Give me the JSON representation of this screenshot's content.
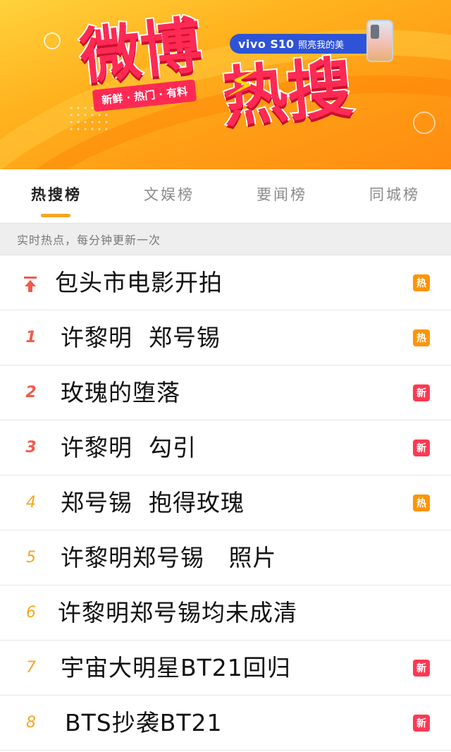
{
  "banner": {
    "logo_top": "微博",
    "logo_bottom": "热搜",
    "tagline": "新鲜 · 热门 · 有料",
    "ad_brand": "vivo",
    "ad_model": "S10",
    "ad_slogan": "照亮我的美"
  },
  "tabs": [
    {
      "label": "热搜榜",
      "active": true
    },
    {
      "label": "文娱榜",
      "active": false
    },
    {
      "label": "要闻榜",
      "active": false
    },
    {
      "label": "同城榜",
      "active": false
    }
  ],
  "subheader": "实时热点，每分钟更新一次",
  "list": [
    {
      "rank": "",
      "pinned": true,
      "title": "包头市电影开拍",
      "badge": "热",
      "badge_type": "hot"
    },
    {
      "rank": "1",
      "pinned": false,
      "title": "许黎明  郑号锡",
      "badge": "热",
      "badge_type": "hot"
    },
    {
      "rank": "2",
      "pinned": false,
      "title": "玫瑰的堕落",
      "badge": "新",
      "badge_type": "new"
    },
    {
      "rank": "3",
      "pinned": false,
      "title": "许黎明  勾引",
      "badge": "新",
      "badge_type": "new"
    },
    {
      "rank": "4",
      "pinned": false,
      "title": "郑号锡  抱得玫瑰",
      "badge": "热",
      "badge_type": "hot"
    },
    {
      "rank": "5",
      "pinned": false,
      "title": "许黎明郑号锡   照片",
      "badge": "",
      "badge_type": ""
    },
    {
      "rank": "6",
      "pinned": false,
      "title": "许黎明郑号锡均未成清",
      "badge": "",
      "badge_type": ""
    },
    {
      "rank": "7",
      "pinned": false,
      "title": "宇宙大明星BT21回归",
      "badge": "新",
      "badge_type": "new"
    },
    {
      "rank": "8",
      "pinned": false,
      "title": "BTS抄袭BT21",
      "badge": "新",
      "badge_type": "new"
    }
  ],
  "colors": {
    "accent": "#f5a623",
    "hot_badge": "#ff9406",
    "new_badge": "#ff3852",
    "top_rank": "#f25a4a"
  },
  "icons": {
    "pin": "arrow-to-top-icon",
    "phone": "phone-icon"
  }
}
